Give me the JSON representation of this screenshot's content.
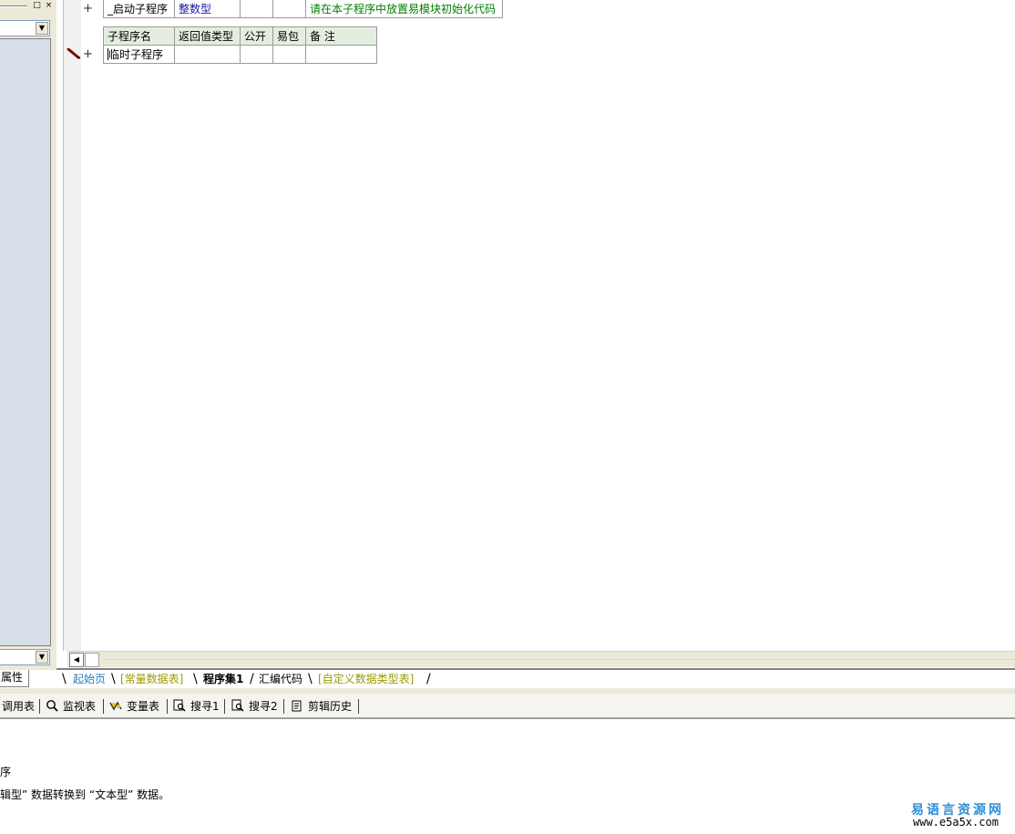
{
  "left_panel": {
    "tab_label": "属性"
  },
  "editor": {
    "program_table": {
      "name": "_启动子程序",
      "return_type": "整数型",
      "public": "",
      "easy_pack": "",
      "comment": "请在本子程序中放置易模块初始化代码"
    },
    "subroutine_table": {
      "headers": [
        "子程序名",
        "返回值类型",
        "公开",
        "易包",
        "备 注"
      ],
      "row": {
        "name": "临时子程序",
        "return_type": "",
        "public": "",
        "easy_pack": "",
        "comment": ""
      }
    },
    "plus_sign": "+"
  },
  "tabs": [
    {
      "label": "起始页",
      "color": "#1f7fbf"
    },
    {
      "label": "[常量数据表]",
      "color": "#9a9a00"
    },
    {
      "label": "程序集1",
      "color": "#000000"
    },
    {
      "label": "汇编代码",
      "color": "#000000"
    },
    {
      "label": "[自定义数据类型表]",
      "color": "#9a9a00"
    }
  ],
  "toolbar": {
    "items": [
      {
        "label": "调用表",
        "icon": "call-table-icon"
      },
      {
        "label": "监视表",
        "icon": "magnifier-icon"
      },
      {
        "label": "变量表",
        "icon": "variable-table-icon"
      },
      {
        "label": "搜寻1",
        "icon": "search-doc-icon"
      },
      {
        "label": "搜寻2",
        "icon": "search-doc-icon"
      },
      {
        "label": "剪辑历史",
        "icon": "clipboard-icon"
      }
    ]
  },
  "output": {
    "line1": "序",
    "line2": "辑型” 数据转换到 “文本型” 数据。"
  },
  "watermark": {
    "title": "易语言资源网",
    "url": "www.e5a5x.com"
  }
}
